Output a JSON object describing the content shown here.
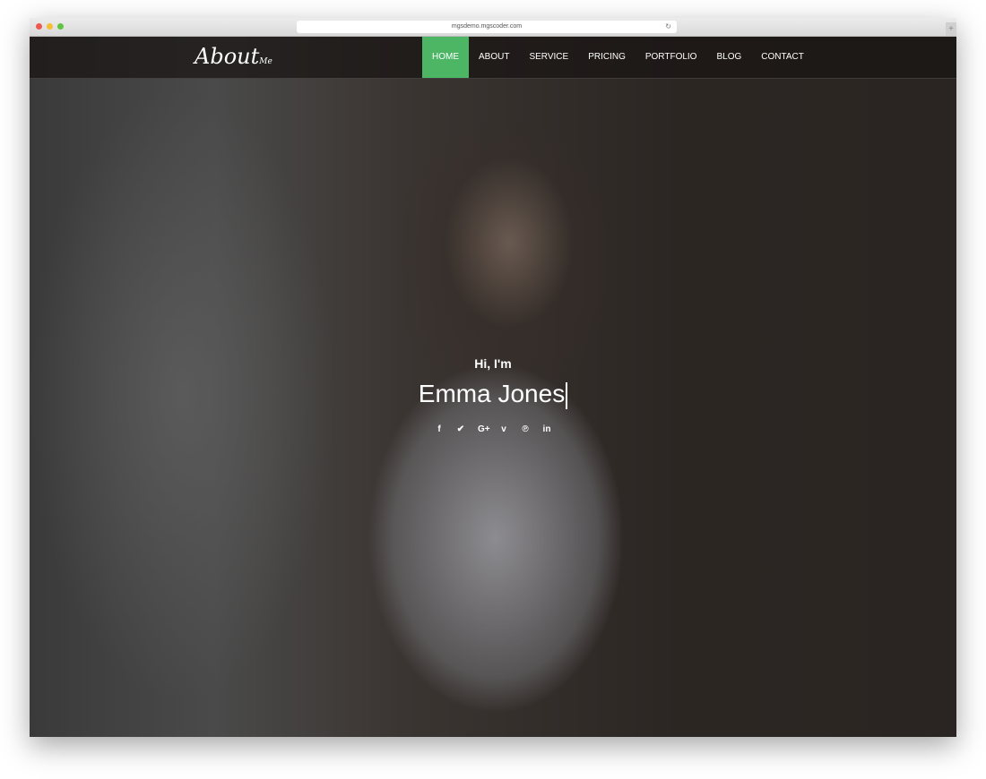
{
  "browser": {
    "url": "mgsdemo.mgscoder.com",
    "dot_colors": [
      "#ee5a52",
      "#f5be33",
      "#5fc43f"
    ]
  },
  "nav": {
    "logo_main": "About",
    "logo_sub": "Me",
    "accent": "#4cb665",
    "items": [
      {
        "label": "HOME",
        "active": true
      },
      {
        "label": "ABOUT"
      },
      {
        "label": "SERVICE"
      },
      {
        "label": "PRICING"
      },
      {
        "label": "PORTFOLIO"
      },
      {
        "label": "BLOG"
      },
      {
        "label": "CONTACT"
      }
    ]
  },
  "hero": {
    "greeting": "Hi, I'm",
    "name": "Emma Jones",
    "social": [
      {
        "icon": "facebook-icon",
        "glyph": "f"
      },
      {
        "icon": "twitter-icon",
        "glyph": "🐦"
      },
      {
        "icon": "google-plus-icon",
        "glyph": "G+"
      },
      {
        "icon": "vimeo-icon",
        "glyph": "v"
      },
      {
        "icon": "pinterest-icon",
        "glyph": "℗"
      },
      {
        "icon": "linkedin-icon",
        "glyph": "in"
      }
    ]
  }
}
